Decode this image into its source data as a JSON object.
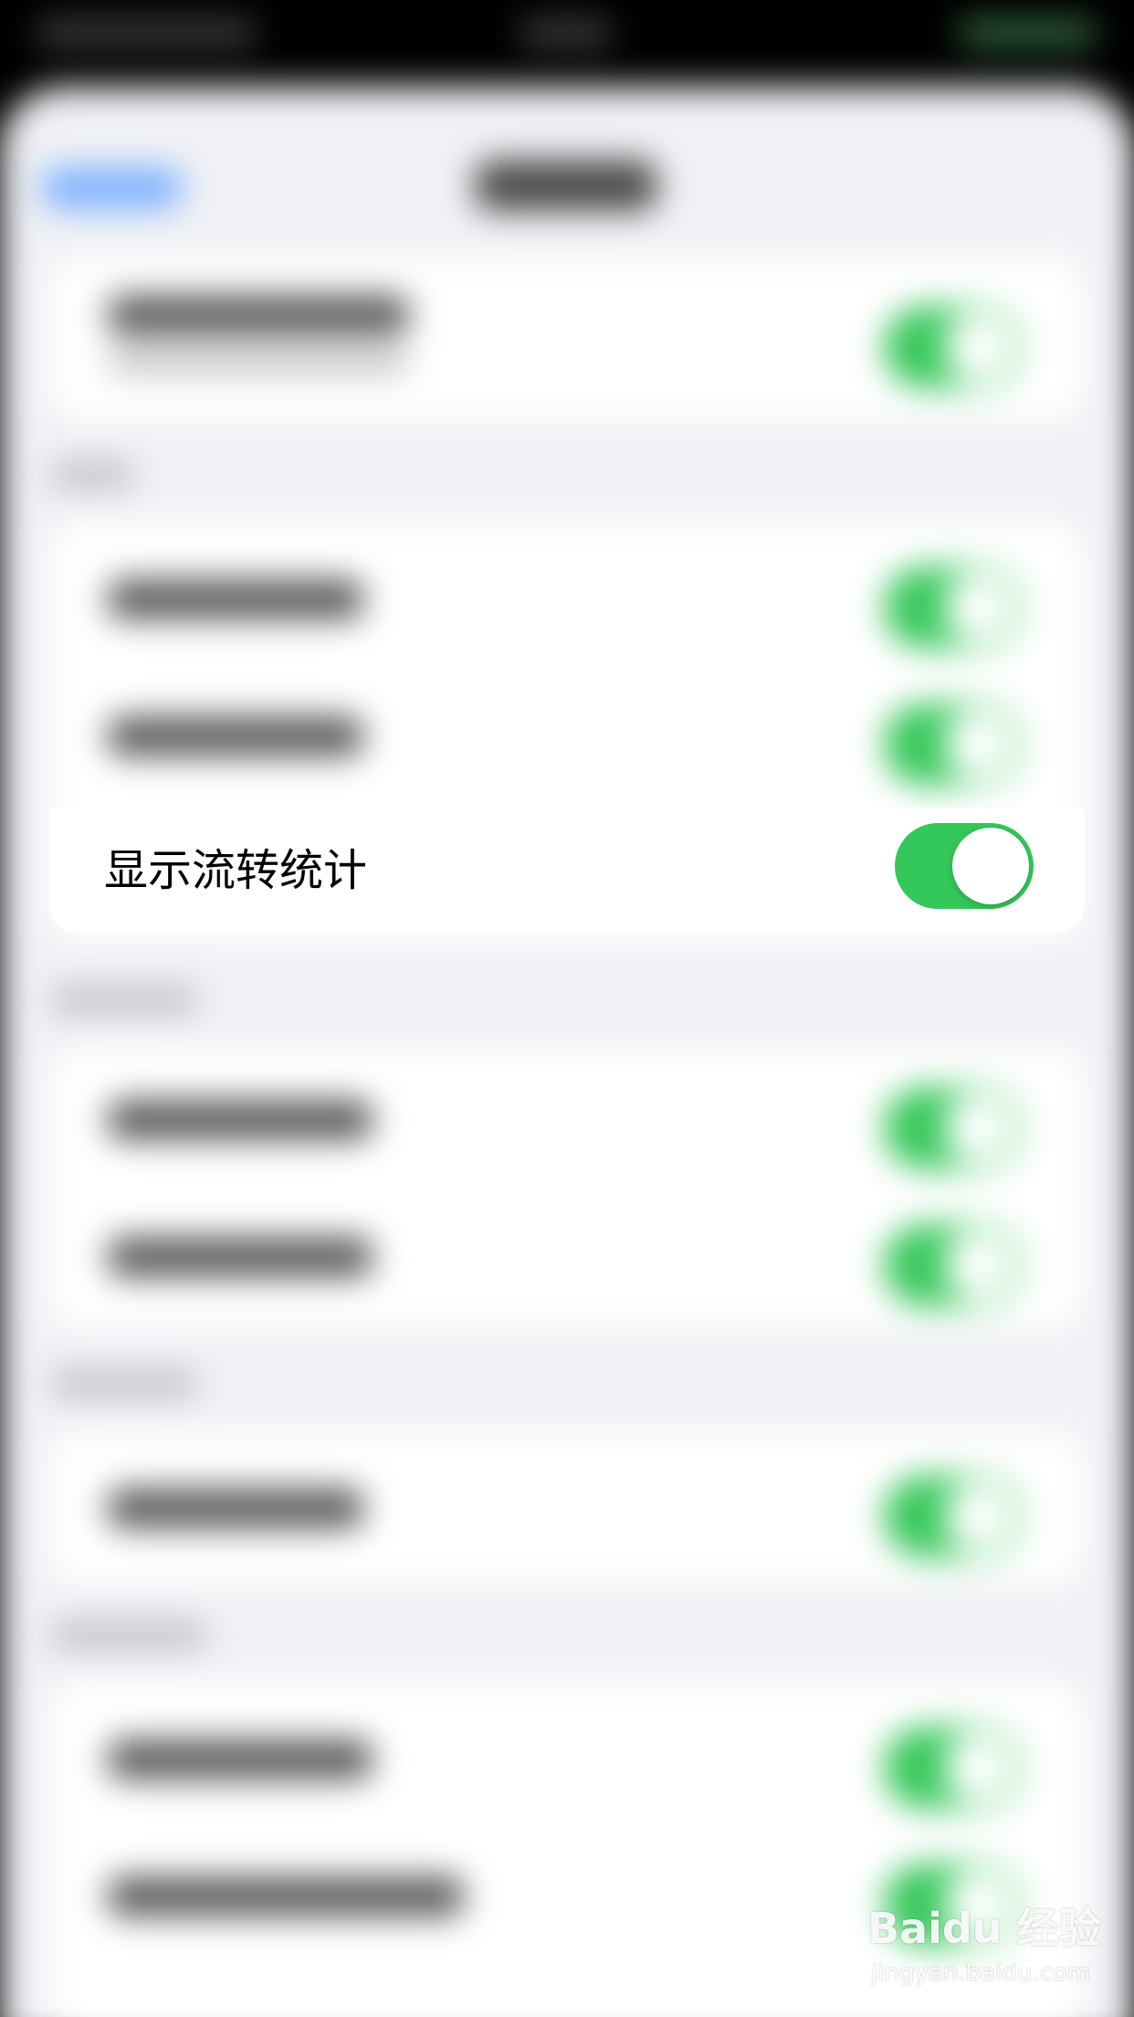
{
  "focused_setting": {
    "label": "显示流转统计",
    "toggle_on": true,
    "accent_color": "#34C759"
  },
  "watermark": {
    "logo": "Baidu 经验",
    "url": "jingyan.baidu.com"
  }
}
